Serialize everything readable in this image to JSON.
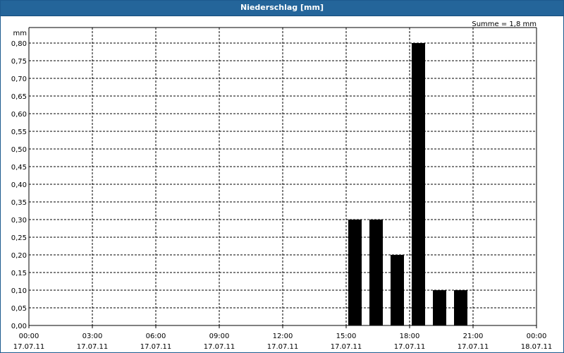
{
  "window": {
    "title": "Niederschlag [mm]"
  },
  "chart_data": {
    "type": "bar",
    "title": "Niederschlag [mm]",
    "ylabel": "mm",
    "annotation": "Summe = 1,8 mm",
    "ylim": [
      0,
      0.8
    ],
    "yticks": [
      "0,00",
      "0,05",
      "0,10",
      "0,15",
      "0,20",
      "0,25",
      "0,30",
      "0,35",
      "0,40",
      "0,45",
      "0,50",
      "0,55",
      "0,60",
      "0,65",
      "0,70",
      "0,75",
      "0,80"
    ],
    "xlim_hours": [
      0,
      24
    ],
    "xticks": [
      {
        "time": "00:00",
        "date": "17.07.11"
      },
      {
        "time": "03:00",
        "date": "17.07.11"
      },
      {
        "time": "06:00",
        "date": "17.07.11"
      },
      {
        "time": "09:00",
        "date": "17.07.11"
      },
      {
        "time": "12:00",
        "date": "17.07.11"
      },
      {
        "time": "15:00",
        "date": "17.07.11"
      },
      {
        "time": "18:00",
        "date": "17.07.11"
      },
      {
        "time": "21:00",
        "date": "17.07.11"
      },
      {
        "time": "00:00",
        "date": "18.07.11"
      }
    ],
    "grid": true,
    "bar_color": "#000000",
    "bars": [
      {
        "start": "15:00",
        "end": "16:00",
        "value": 0.3
      },
      {
        "start": "16:00",
        "end": "17:00",
        "value": 0.3
      },
      {
        "start": "17:00",
        "end": "18:00",
        "value": 0.2
      },
      {
        "start": "18:00",
        "end": "19:00",
        "value": 0.8
      },
      {
        "start": "19:00",
        "end": "20:00",
        "value": 0.1
      },
      {
        "start": "20:00",
        "end": "21:00",
        "value": 0.1
      }
    ]
  }
}
